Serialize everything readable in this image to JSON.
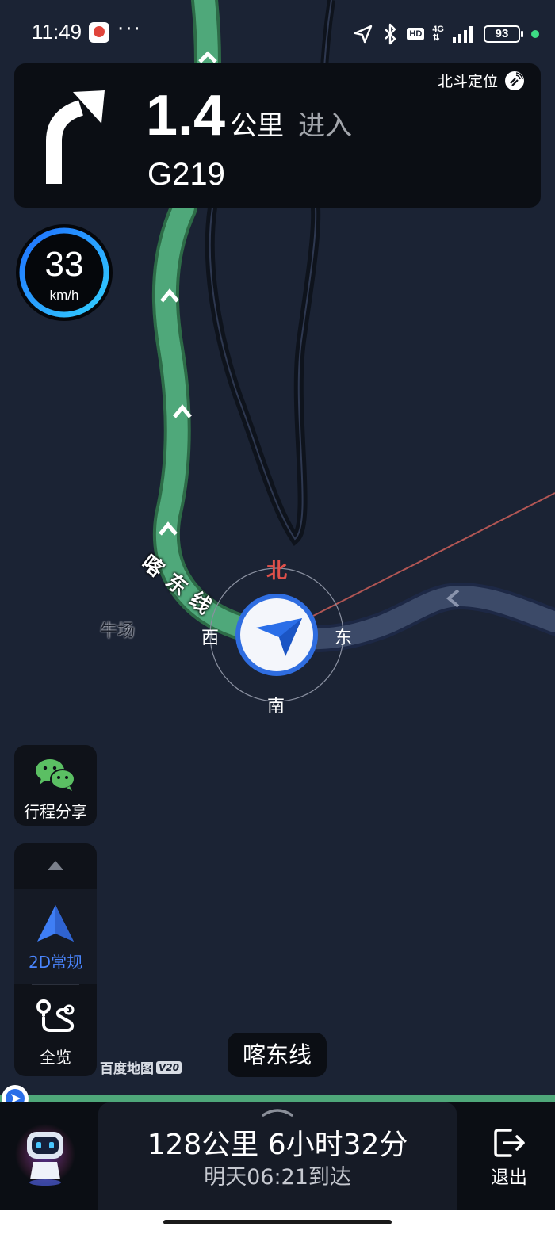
{
  "status_bar": {
    "time": "11:49",
    "more": "···",
    "hd": "HD",
    "network": "4G",
    "battery": "93"
  },
  "guidance": {
    "maneuver_icon": "turn-right-arrow",
    "distance": "1.4",
    "unit": "公里",
    "action": "进入",
    "road": "G219",
    "positioning_label": "北斗定位"
  },
  "speed": {
    "value": "33",
    "unit": "km/h"
  },
  "map": {
    "road_label": "喀东线",
    "place_label": "牛场",
    "compass": {
      "north": "北",
      "south": "南",
      "east": "东",
      "west": "西"
    }
  },
  "controls": {
    "share_label": "行程分享",
    "mode_2d_label": "2D常规",
    "overview_label": "全览"
  },
  "branding": {
    "logo_text": "百度地图",
    "version": "V20"
  },
  "current_road": "喀东线",
  "trip": {
    "summary": "128公里 6小时32分",
    "arrival": "明天06:21到达"
  },
  "exit_label": "退出",
  "colors": {
    "map_bg": "#1b2334",
    "route_green": "#4fa87a",
    "passed_route": "#3c4a68",
    "accent_blue": "#4a86ff",
    "compass_north": "#e0504a"
  }
}
